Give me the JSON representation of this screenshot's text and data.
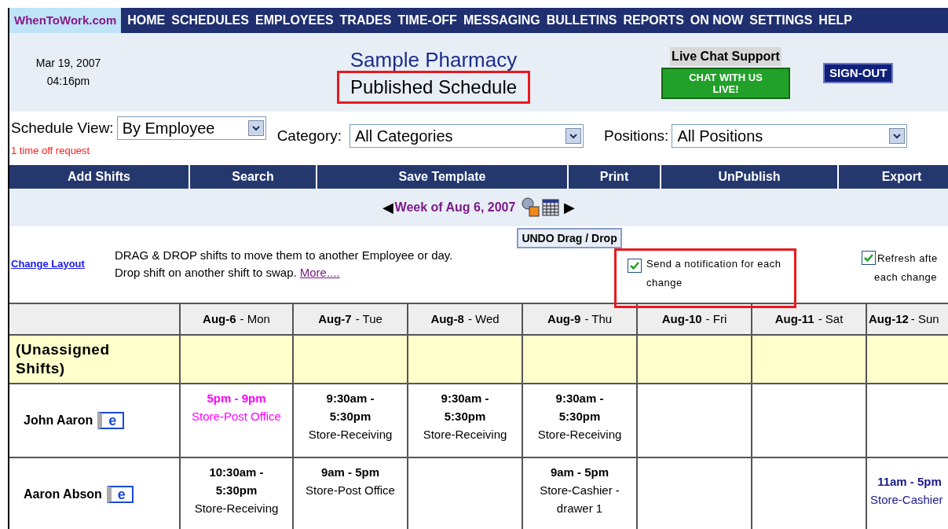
{
  "logo": "WhenToWork.com",
  "nav": [
    "HOME",
    "SCHEDULES",
    "EMPLOYEES",
    "TRADES",
    "TIME-OFF",
    "MESSAGING",
    "BULLETINS",
    "REPORTS",
    "ON NOW",
    "SETTINGS",
    "HELP"
  ],
  "header": {
    "date": "Mar 19, 2007",
    "time": "04:16pm",
    "company": "Sample Pharmacy",
    "title": "Published Schedule",
    "title_highlighted": true,
    "chat_label": "Live Chat Support",
    "chat_button": "CHAT WITH US LIVE!",
    "signout": "SIGN-OUT"
  },
  "filters": {
    "view_label": "Schedule View:",
    "view_value": "By Employee",
    "notice": "1 time off request",
    "category_label": "Category:",
    "category_value": "All Categories",
    "positions_label": "Positions:",
    "positions_value": "All Positions"
  },
  "toolbar": [
    "Add Shifts",
    "Search",
    "Save Template",
    "Print",
    "UnPublish",
    "Export"
  ],
  "week": {
    "prev": "◀",
    "label": "Week of Aug 6, 2007",
    "next": "▶"
  },
  "instructions": {
    "change_layout": "Change Layout",
    "line1": "DRAG & DROP shifts to move them to another Employee or day.",
    "line2": "Drop shift on another shift to swap.",
    "more": "More....",
    "undo": "UNDO Drag / Drop"
  },
  "options": [
    {
      "label": "Send a notification for each change",
      "checked": true,
      "highlighted": true
    },
    {
      "label": "Refresh afte each change",
      "checked": true,
      "highlighted": false
    }
  ],
  "table": {
    "columns": [
      {
        "date": "Aug-6",
        "day": "- Mon"
      },
      {
        "date": "Aug-7",
        "day": "- Tue"
      },
      {
        "date": "Aug-8",
        "day": "- Wed"
      },
      {
        "date": "Aug-9",
        "day": "- Thu"
      },
      {
        "date": "Aug-10",
        "day": "- Fri"
      },
      {
        "date": "Aug-11",
        "day": "- Sat"
      },
      {
        "date": "Aug-12",
        "day": "- Sun"
      }
    ],
    "unassigned": "(Unassigned Shifts)",
    "rows": [
      {
        "name": "John Aaron",
        "email": "e",
        "shifts": [
          {
            "kind": "shift",
            "time": "5pm - 9pm",
            "position": "Store-Post Office",
            "color": "#ff00ff"
          },
          {
            "kind": "shift",
            "time": "9:30am - 5:30pm",
            "position": "Store-Receiving",
            "color": "#000000"
          },
          {
            "kind": "shift",
            "time": "9:30am - 5:30pm",
            "position": "Store-Receiving",
            "color": "#000000"
          },
          {
            "kind": "shift",
            "time": "9:30am - 5:30pm",
            "position": "Store-Receiving",
            "color": "#000000"
          },
          {
            "kind": "empty"
          },
          {
            "kind": "empty"
          },
          {
            "kind": "empty"
          }
        ]
      },
      {
        "name": "Aaron Abson",
        "email": "e",
        "shifts": [
          {
            "kind": "shift",
            "time": "10:30am - 5:30pm",
            "position": "Store-Receiving",
            "color": "#000000"
          },
          {
            "kind": "shift",
            "time": "9am - 5pm",
            "position": "Store-Post Office",
            "color": "#000000"
          },
          {
            "kind": "empty"
          },
          {
            "kind": "shift",
            "time": "9am - 5pm",
            "position": "Store-Cashier -drawer 1",
            "color": "#000000"
          },
          {
            "kind": "empty"
          },
          {
            "kind": "empty"
          },
          {
            "kind": "shift",
            "time": "11am - 5pm",
            "position": "Store-Cashier",
            "color": "#1a1a8c"
          }
        ]
      }
    ]
  }
}
